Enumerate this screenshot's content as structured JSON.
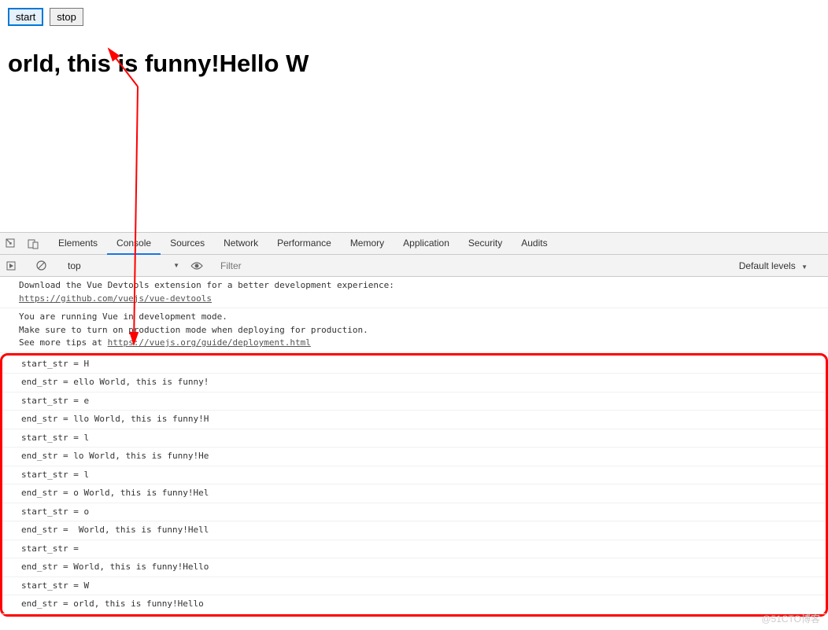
{
  "page": {
    "buttons": {
      "start": "start",
      "stop": "stop"
    },
    "heading": "orld, this is funny!Hello W"
  },
  "devtools": {
    "tabs": [
      "Elements",
      "Console",
      "Sources",
      "Network",
      "Performance",
      "Memory",
      "Application",
      "Security",
      "Audits"
    ],
    "activeTab": "Console",
    "toolbar": {
      "context": "top",
      "filterPlaceholder": "Filter",
      "levels": "Default levels"
    },
    "messages": {
      "info1_line1": "Download the Vue Devtools extension for a better development experience:",
      "info1_link": "https://github.com/vuejs/vue-devtools",
      "info2_line1": "You are running Vue in development mode.",
      "info2_line2": "Make sure to turn on production mode when deploying for production.",
      "info2_line3_prefix": "See more tips at ",
      "info2_link": "https://vuejs.org/guide/deployment.html"
    },
    "logs": [
      "start_str = H",
      "end_str = ello World, this is funny!",
      "start_str = e",
      "end_str = llo World, this is funny!H",
      "start_str = l",
      "end_str = lo World, this is funny!He",
      "start_str = l",
      "end_str = o World, this is funny!Hel",
      "start_str = o",
      "end_str =  World, this is funny!Hell",
      "start_str = ",
      "end_str = World, this is funny!Hello ",
      "start_str = W",
      "end_str = orld, this is funny!Hello "
    ]
  },
  "watermark": "@51CTO博客"
}
